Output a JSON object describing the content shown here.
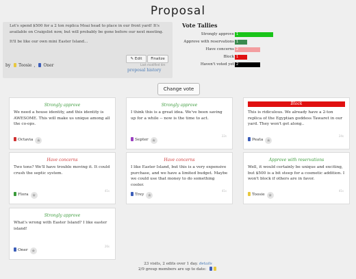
{
  "page": {
    "title": "Proposal"
  },
  "proposal": {
    "paragraph1": "Let's spend $500 for a 2 ton replica Moai head to place in our front yard! It's available on Craigslist now, but will probably be gone before our next meeting.",
    "paragraph2": "It'll be like our own mini Easter Island...",
    "edit_label": "Edit",
    "finalize_label": "Finalize",
    "last_modified": "Last modified 4m",
    "history_link": "proposal history",
    "by_label": "by",
    "authors": [
      "Toosie",
      "Oner"
    ],
    "author_colors": [
      "#e8c840",
      "#3b5db8"
    ]
  },
  "tallies": {
    "title": "Vote Tallies",
    "rows": [
      {
        "label": "Strongly approve",
        "count": "1",
        "color": "#19c419",
        "fraction": 1.0
      },
      {
        "label": "Approve with reservations",
        "count": "1",
        "color": "#3a8a4f",
        "fraction": 0.33
      },
      {
        "label": "Have concerns",
        "count": "2",
        "color": "#f39ea0",
        "fraction": 0.66
      },
      {
        "label": "Block",
        "count": "1",
        "color": "#e01010",
        "fraction": 0.33
      },
      {
        "label": "Haven't voted yet",
        "count": "2",
        "color": "#000000",
        "fraction": 0.66
      }
    ]
  },
  "change_vote_label": "Change vote",
  "cards": [
    {
      "head": "Strongly approve",
      "head_color": "#3a9a3a",
      "block": false,
      "body": "We need a house identity, and this identity is AWESOME. This will make us unique among all the co-ops.",
      "author": "Octavia",
      "author_color": "#d03030",
      "age": ""
    },
    {
      "head": "Strongly approve",
      "head_color": "#3a9a3a",
      "block": false,
      "body": "I think this is a great idea. We've been saving up for a while -- now is the time to act.",
      "author": "Septer",
      "author_color": "#9a40c0",
      "age": "22s"
    },
    {
      "head": "Block",
      "head_color": "#ffffff",
      "block": true,
      "body": "This is ridiculous. We already have a 2-ton replica of the Egyptian goddess Tawaret in our yard. They won't get along..",
      "author": "Peata",
      "author_color": "#3b5db8",
      "age": "24s"
    },
    {
      "head": "Have concerns",
      "head_color": "#d04040",
      "block": false,
      "body": "Two tons? We'll have trouble moving it. It could crush the septic system.",
      "author": "Flora",
      "author_color": "#3a9a3a",
      "age": "41s"
    },
    {
      "head": "Have concerns",
      "head_color": "#d04040",
      "block": false,
      "body": "I like Easter Island, but this is a very expensive purchase, and we have a limited budget. Maybe we could use that money to do something cooler.",
      "author": "Trey",
      "author_color": "#3b5db8",
      "age": "41s"
    },
    {
      "head": "Approve with reservations",
      "head_color": "#3a9a3a",
      "block": false,
      "body": "Well, it would certainly be unique and exciting, but $500 is a bit steep for a cosmetic addition. I won't block if others are in favor.",
      "author": "Toosie",
      "author_color": "#e8c840",
      "age": "41s"
    },
    {
      "head": "Strongly approve",
      "head_color": "#3a9a3a",
      "block": false,
      "body": "What's wrong with Easter Island? I like easter island!",
      "author": "Oner",
      "author_color": "#3b5db8",
      "age": "26s"
    }
  ],
  "footer": {
    "line1": "23 visits, 2 edits over 1 day.",
    "details_link": "details",
    "line2": "2/9 group members are up to date:"
  }
}
